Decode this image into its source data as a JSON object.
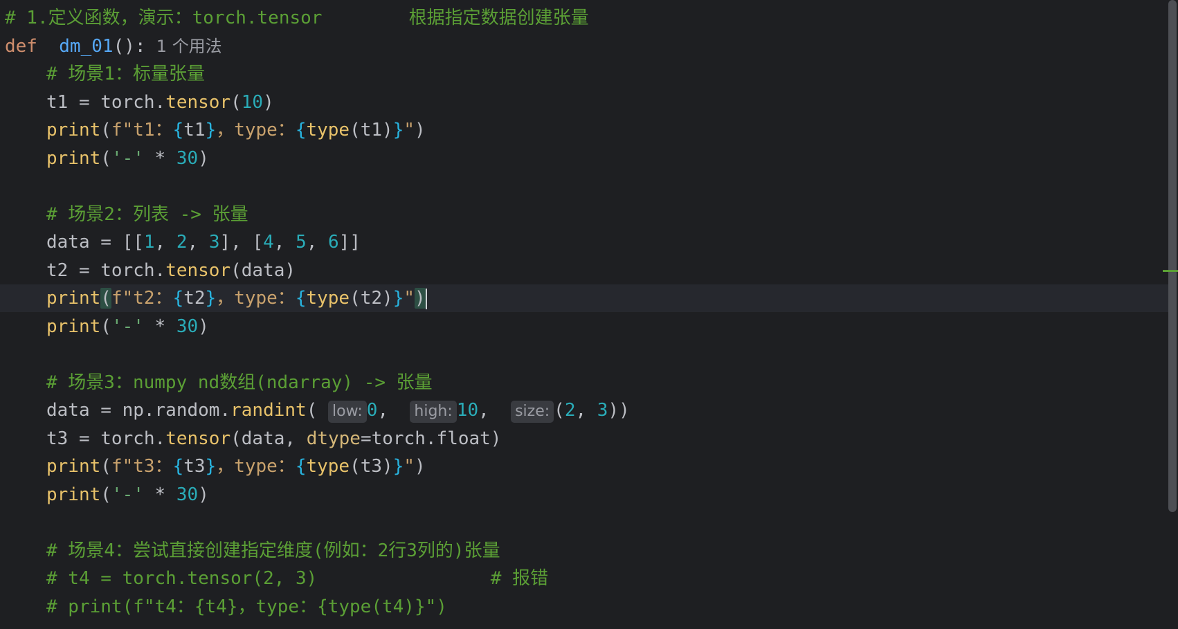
{
  "lines": [
    {
      "segments": [
        [
          "cm",
          "# 1.定义函数，演示：torch.tensor        根据指定数据创建张量"
        ]
      ]
    },
    {
      "segments": [
        [
          "kw",
          "def"
        ],
        [
          "",
          "  "
        ],
        [
          "fn",
          "dm_01"
        ],
        [
          "",
          "():"
        ]
      ],
      "hint": "1 个用法"
    },
    {
      "indent": true,
      "segments": [
        [
          "cm",
          "# 场景1：标量张量"
        ]
      ]
    },
    {
      "indent": true,
      "segments": [
        [
          "",
          "t1 = torch."
        ],
        [
          "call",
          "tensor"
        ],
        [
          "",
          "("
        ],
        [
          "num",
          "10"
        ],
        [
          "",
          ")"
        ]
      ]
    },
    {
      "indent": true,
      "segments": [
        [
          "call",
          "print"
        ],
        [
          "",
          "("
        ],
        [
          "fs",
          "f\"t1："
        ],
        [
          "br",
          "{"
        ],
        [
          "",
          "t1"
        ],
        [
          "br",
          "}"
        ],
        [
          "fs",
          "，type："
        ],
        [
          "br",
          "{"
        ],
        [
          "call",
          "type"
        ],
        [
          "",
          "(t1)"
        ],
        [
          "br",
          "}"
        ],
        [
          "fs",
          "\""
        ],
        [
          "",
          ")"
        ]
      ]
    },
    {
      "indent": true,
      "segments": [
        [
          "call",
          "print"
        ],
        [
          "",
          "("
        ],
        [
          "str",
          "'-'"
        ],
        [
          "",
          " * "
        ],
        [
          "num",
          "30"
        ],
        [
          "",
          ")"
        ]
      ]
    },
    {
      "segments": []
    },
    {
      "indent": true,
      "segments": [
        [
          "cm",
          "# 场景2：列表 -> 张量"
        ]
      ]
    },
    {
      "indent": true,
      "segments": [
        [
          "",
          "data = [["
        ],
        [
          "num",
          "1"
        ],
        [
          "",
          ", "
        ],
        [
          "num",
          "2"
        ],
        [
          "",
          ", "
        ],
        [
          "num",
          "3"
        ],
        [
          "",
          "], ["
        ],
        [
          "num",
          "4"
        ],
        [
          "",
          ", "
        ],
        [
          "num",
          "5"
        ],
        [
          "",
          ", "
        ],
        [
          "num",
          "6"
        ],
        [
          "",
          "]]"
        ]
      ]
    },
    {
      "indent": true,
      "segments": [
        [
          "",
          "t2 = torch."
        ],
        [
          "call",
          "tensor"
        ],
        [
          "",
          "(data)"
        ]
      ]
    },
    {
      "indent": true,
      "current": true,
      "segments": [
        [
          "call",
          "print"
        ],
        [
          "match",
          "("
        ],
        [
          "fs",
          "f\"t2："
        ],
        [
          "br",
          "{"
        ],
        [
          "",
          "t2"
        ],
        [
          "br",
          "}"
        ],
        [
          "fs",
          "，type："
        ],
        [
          "br",
          "{"
        ],
        [
          "call",
          "type"
        ],
        [
          "",
          "(t2)"
        ],
        [
          "br",
          "}"
        ],
        [
          "fs",
          "\""
        ],
        [
          "match",
          ")"
        ]
      ]
    },
    {
      "indent": true,
      "segments": [
        [
          "call",
          "print"
        ],
        [
          "",
          "("
        ],
        [
          "str",
          "'-'"
        ],
        [
          "",
          " * "
        ],
        [
          "num",
          "30"
        ],
        [
          "",
          ")"
        ]
      ]
    },
    {
      "segments": []
    },
    {
      "indent": true,
      "segments": [
        [
          "cm",
          "# 场景3：numpy nd数组(ndarray) -> 张量"
        ]
      ]
    },
    {
      "indent": true,
      "segments": [
        [
          "",
          "data = np.random."
        ],
        [
          "call",
          "randint"
        ],
        [
          "",
          "( "
        ],
        [
          "inlay",
          "low:"
        ],
        [
          "num",
          "0"
        ],
        [
          "",
          ",  "
        ],
        [
          "inlay",
          "high:"
        ],
        [
          "num",
          "10"
        ],
        [
          "",
          ",  "
        ],
        [
          "inlay",
          "size:"
        ],
        [
          "",
          "("
        ],
        [
          "num",
          "2"
        ],
        [
          "",
          ", "
        ],
        [
          "num",
          "3"
        ],
        [
          "",
          "))"
        ]
      ]
    },
    {
      "indent": true,
      "segments": [
        [
          "",
          "t3 = torch."
        ],
        [
          "call",
          "tensor"
        ],
        [
          "",
          "(data, "
        ],
        [
          "par",
          "dtype"
        ],
        [
          "",
          "=torch.float)"
        ]
      ]
    },
    {
      "indent": true,
      "segments": [
        [
          "call",
          "print"
        ],
        [
          "",
          "("
        ],
        [
          "fs",
          "f\"t3："
        ],
        [
          "br",
          "{"
        ],
        [
          "",
          "t3"
        ],
        [
          "br",
          "}"
        ],
        [
          "fs",
          "，type："
        ],
        [
          "br",
          "{"
        ],
        [
          "call",
          "type"
        ],
        [
          "",
          "(t3)"
        ],
        [
          "br",
          "}"
        ],
        [
          "fs",
          "\""
        ],
        [
          "",
          ")"
        ]
      ]
    },
    {
      "indent": true,
      "segments": [
        [
          "call",
          "print"
        ],
        [
          "",
          "("
        ],
        [
          "str",
          "'-'"
        ],
        [
          "",
          " * "
        ],
        [
          "num",
          "30"
        ],
        [
          "",
          ")"
        ]
      ]
    },
    {
      "segments": []
    },
    {
      "indent": true,
      "segments": [
        [
          "cm",
          "# 场景4：尝试直接创建指定维度(例如：2行3列的)张量"
        ]
      ]
    },
    {
      "indent": true,
      "segments": [
        [
          "cm",
          "# t4 = torch.tensor(2, 3)                # 报错"
        ]
      ]
    },
    {
      "indent": true,
      "segments": [
        [
          "cm",
          "# print(f\"t4：{t4}，type：{type(t4)}\")"
        ]
      ]
    }
  ]
}
